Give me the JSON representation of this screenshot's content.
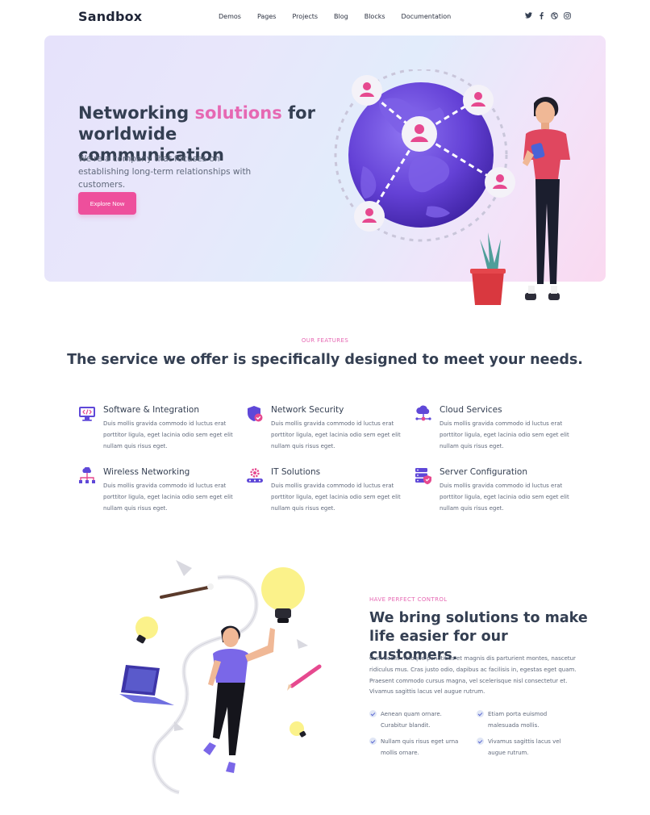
{
  "brand": {
    "logo": "Sandbox"
  },
  "nav": {
    "items": [
      "Demos",
      "Pages",
      "Projects",
      "Blog",
      "Blocks",
      "Documentation"
    ]
  },
  "social": [
    "twitter-icon",
    "facebook-icon",
    "dribbble-icon",
    "instagram-icon"
  ],
  "hero": {
    "title_part1": "Networking ",
    "title_accent": "solutions",
    "title_part2": " for worldwide communication",
    "subtitle": "We're a company that focuses on establishing long-term relationships with customers.",
    "button": "Explore Now"
  },
  "features": {
    "eyebrow": "OUR FEATURES",
    "title": "The service we offer is specifically designed to meet your needs.",
    "items": [
      {
        "title": "Software & Integration",
        "text": "Duis mollis gravida commodo id luctus erat porttitor ligula, eget lacinia odio sem eget elit nullam quis risus eget.",
        "icon": "code-monitor-icon"
      },
      {
        "title": "Network Security",
        "text": "Duis mollis gravida commodo id luctus erat porttitor ligula, eget lacinia odio sem eget elit nullam quis risus eget.",
        "icon": "shield-icon"
      },
      {
        "title": "Cloud Services",
        "text": "Duis mollis gravida commodo id luctus erat porttitor ligula, eget lacinia odio sem eget elit nullam quis risus eget.",
        "icon": "cloud-network-icon"
      },
      {
        "title": "Wireless Networking",
        "text": "Duis mollis gravida commodo id luctus erat porttitor ligula, eget lacinia odio sem eget elit nullam quis risus eget.",
        "icon": "wireless-network-icon"
      },
      {
        "title": "IT Solutions",
        "text": "Duis mollis gravida commodo id luctus erat porttitor ligula, eget lacinia odio sem eget elit nullam quis risus eget.",
        "icon": "gear-icon"
      },
      {
        "title": "Server Configuration",
        "text": "Duis mollis gravida commodo id luctus erat porttitor ligula, eget lacinia odio sem eget elit nullam quis risus eget.",
        "icon": "server-icon"
      }
    ]
  },
  "solutions": {
    "eyebrow": "HAVE PERFECT CONTROL",
    "title": "We bring solutions to make life easier for our customers.",
    "text": "Cum sociis natoque penatibus et magnis dis parturient montes, nascetur ridiculus mus. Cras justo odio, dapibus ac facilisis in, egestas eget quam. Praesent commodo cursus magna, vel scelerisque nisl consectetur et. Vivamus sagittis lacus vel augue rutrum.",
    "checks": [
      "Aenean quam ornare. Curabitur blandit.",
      "Etiam porta euismod malesuada mollis.",
      "Nullam quis risus eget urna mollis ornare.",
      "Vivamus sagittis lacus vel augue rutrum."
    ]
  },
  "colors": {
    "accent": "#e668b3",
    "button": "#ee4f9c",
    "purple": "#6c4fe0",
    "heading": "#343f52"
  }
}
